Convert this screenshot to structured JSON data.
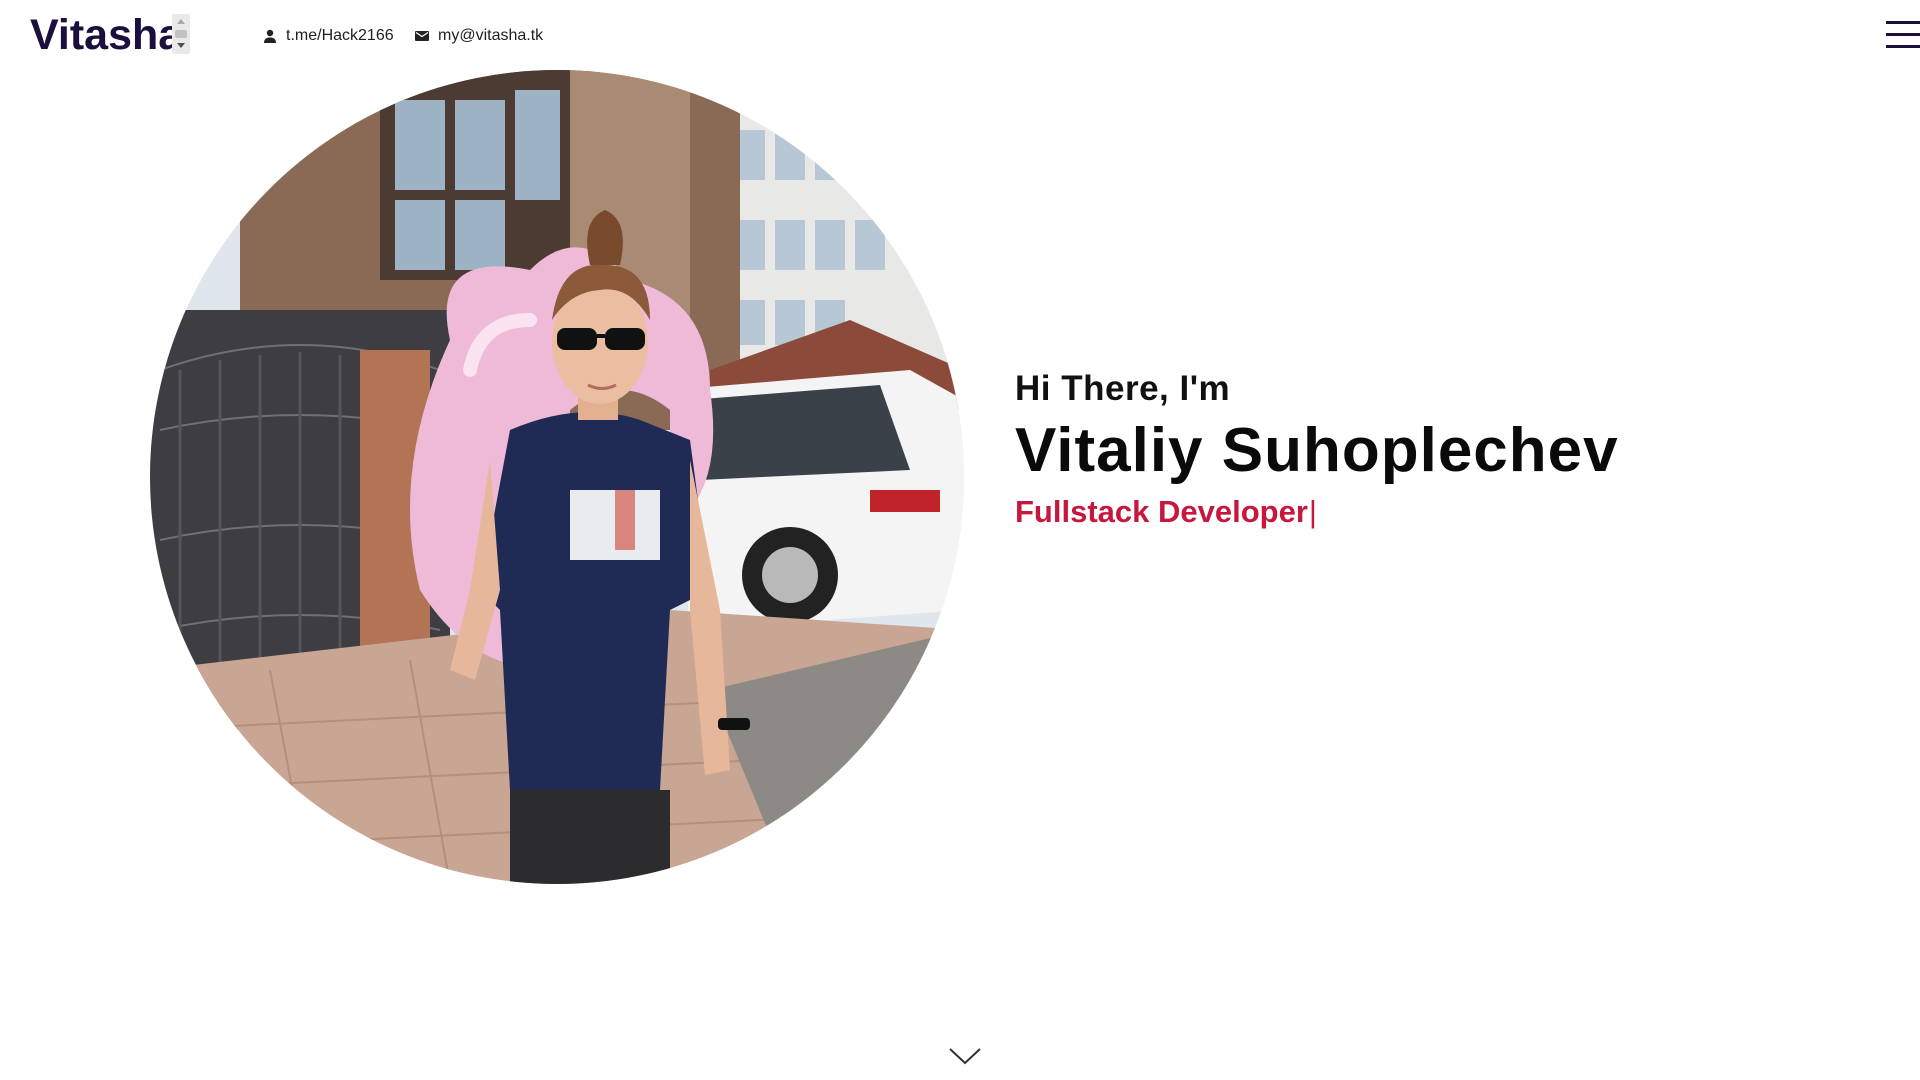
{
  "header": {
    "logo": "Vitasha",
    "telegram": {
      "label": "t.me/Hack2166",
      "icon": "person-icon"
    },
    "email": {
      "label": "my@vitasha.tk",
      "icon": "mail-icon"
    },
    "menu_icon": "hamburger-menu-icon"
  },
  "hero": {
    "greeting": "Hi There, I'm",
    "name": "Vitaliy Suhoplechev",
    "role": "Fullstack Developer",
    "cursor": "|",
    "scroll_icon": "chevron-down-icon"
  },
  "colors": {
    "logo": "#1a0f3d",
    "accent": "#c8173c",
    "text": "#111111",
    "background": "#ffffff"
  }
}
